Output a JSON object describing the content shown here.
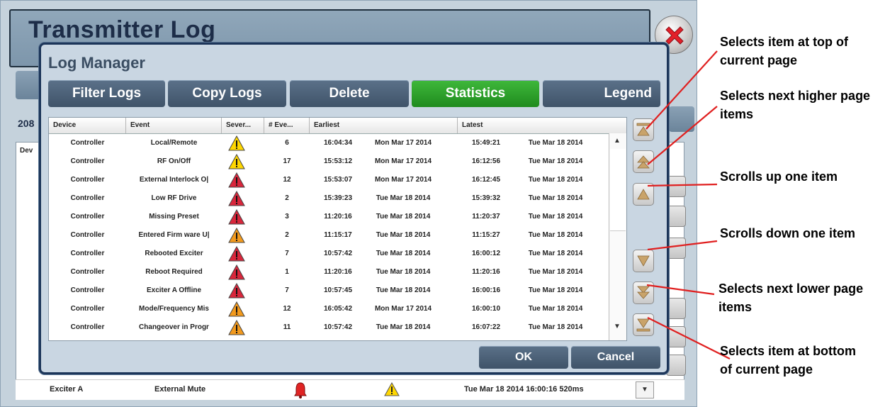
{
  "background": {
    "title": "Transmitter Log",
    "partial_count": "208",
    "column_device": "Dev",
    "bottom_row": {
      "device": "Exciter A",
      "event": "External Mute",
      "latest": "Tue Mar 18 2014 16:00:16 520ms"
    }
  },
  "modal": {
    "title": "Log Manager",
    "toolbar": {
      "filter_label": "Filter Logs",
      "copy_label": "Copy Logs",
      "delete_label": "Delete",
      "statistics_label": "Statistics",
      "legend_label": "Legend"
    },
    "columns": [
      "Device",
      "Event",
      "Sever...",
      "# Eve...",
      "Earliest",
      "Latest"
    ],
    "rows": [
      {
        "device": "Controller",
        "event": "Local/Remote",
        "severity": "warning",
        "count": "6",
        "earliest_time": "16:04:34",
        "earliest_date": "Mon Mar 17 2014",
        "latest_time": "15:49:21",
        "latest_date": "Tue Mar 18 2014"
      },
      {
        "device": "Controller",
        "event": "RF On/Off",
        "severity": "warning",
        "count": "17",
        "earliest_time": "15:53:12",
        "earliest_date": "Mon Mar 17 2014",
        "latest_time": "16:12:56",
        "latest_date": "Tue Mar 18 2014"
      },
      {
        "device": "Controller",
        "event": "External Interlock O|",
        "severity": "critical",
        "count": "12",
        "earliest_time": "15:53:07",
        "earliest_date": "Mon Mar 17 2014",
        "latest_time": "16:12:45",
        "latest_date": "Tue Mar 18 2014"
      },
      {
        "device": "Controller",
        "event": "Low RF Drive",
        "severity": "critical",
        "count": "2",
        "earliest_time": "15:39:23",
        "earliest_date": "Tue Mar 18 2014",
        "latest_time": "15:39:32",
        "latest_date": "Tue Mar 18 2014"
      },
      {
        "device": "Controller",
        "event": "Missing Preset",
        "severity": "critical",
        "count": "3",
        "earliest_time": "11:20:16",
        "earliest_date": "Tue Mar 18 2014",
        "latest_time": "11:20:37",
        "latest_date": "Tue Mar 18 2014"
      },
      {
        "device": "Controller",
        "event": "Entered Firm ware U|",
        "severity": "major",
        "count": "2",
        "earliest_time": "11:15:17",
        "earliest_date": "Tue Mar 18 2014",
        "latest_time": "11:15:27",
        "latest_date": "Tue Mar 18 2014"
      },
      {
        "device": "Controller",
        "event": "Rebooted Exciter",
        "severity": "critical",
        "count": "7",
        "earliest_time": "10:57:42",
        "earliest_date": "Tue Mar 18 2014",
        "latest_time": "16:00:12",
        "latest_date": "Tue Mar 18 2014"
      },
      {
        "device": "Controller",
        "event": "Reboot Required",
        "severity": "critical",
        "count": "1",
        "earliest_time": "11:20:16",
        "earliest_date": "Tue Mar 18 2014",
        "latest_time": "11:20:16",
        "latest_date": "Tue Mar 18 2014"
      },
      {
        "device": "Controller",
        "event": "Exciter A Offline",
        "severity": "critical",
        "count": "7",
        "earliest_time": "10:57:45",
        "earliest_date": "Tue Mar 18 2014",
        "latest_time": "16:00:16",
        "latest_date": "Tue Mar 18 2014"
      },
      {
        "device": "Controller",
        "event": "Mode/Frequency Mis",
        "severity": "major",
        "count": "12",
        "earliest_time": "16:05:42",
        "earliest_date": "Mon Mar 17 2014",
        "latest_time": "16:00:10",
        "latest_date": "Tue Mar 18 2014"
      },
      {
        "device": "Controller",
        "event": "Changeover in Progr",
        "severity": "major",
        "count": "11",
        "earliest_time": "10:57:42",
        "earliest_date": "Tue Mar 18 2014",
        "latest_time": "16:07:22",
        "latest_date": "Tue Mar 18 2014"
      }
    ],
    "ok_label": "OK",
    "cancel_label": "Cancel"
  },
  "callouts": {
    "top_of_page": "Selects item at top of current page",
    "next_higher": "Selects next higher page items",
    "scroll_up": "Scrolls up one item",
    "scroll_down": "Scrolls down one item",
    "next_lower": "Selects next lower page items",
    "bottom_of_page": "Selects item at bottom of current page"
  },
  "colors": {
    "warning_yellow": "#ffd700",
    "critical_red": "#d9263b",
    "major_orange": "#f39a1d",
    "statistics_green": "#2ea52b",
    "callout_line": "#e02020"
  },
  "icons": [
    "close-icon",
    "warning-icon",
    "alarm-bell-icon",
    "top-of-page-icon",
    "page-up-icon",
    "scroll-up-icon",
    "scroll-down-icon",
    "page-down-icon",
    "bottom-of-page-icon"
  ]
}
